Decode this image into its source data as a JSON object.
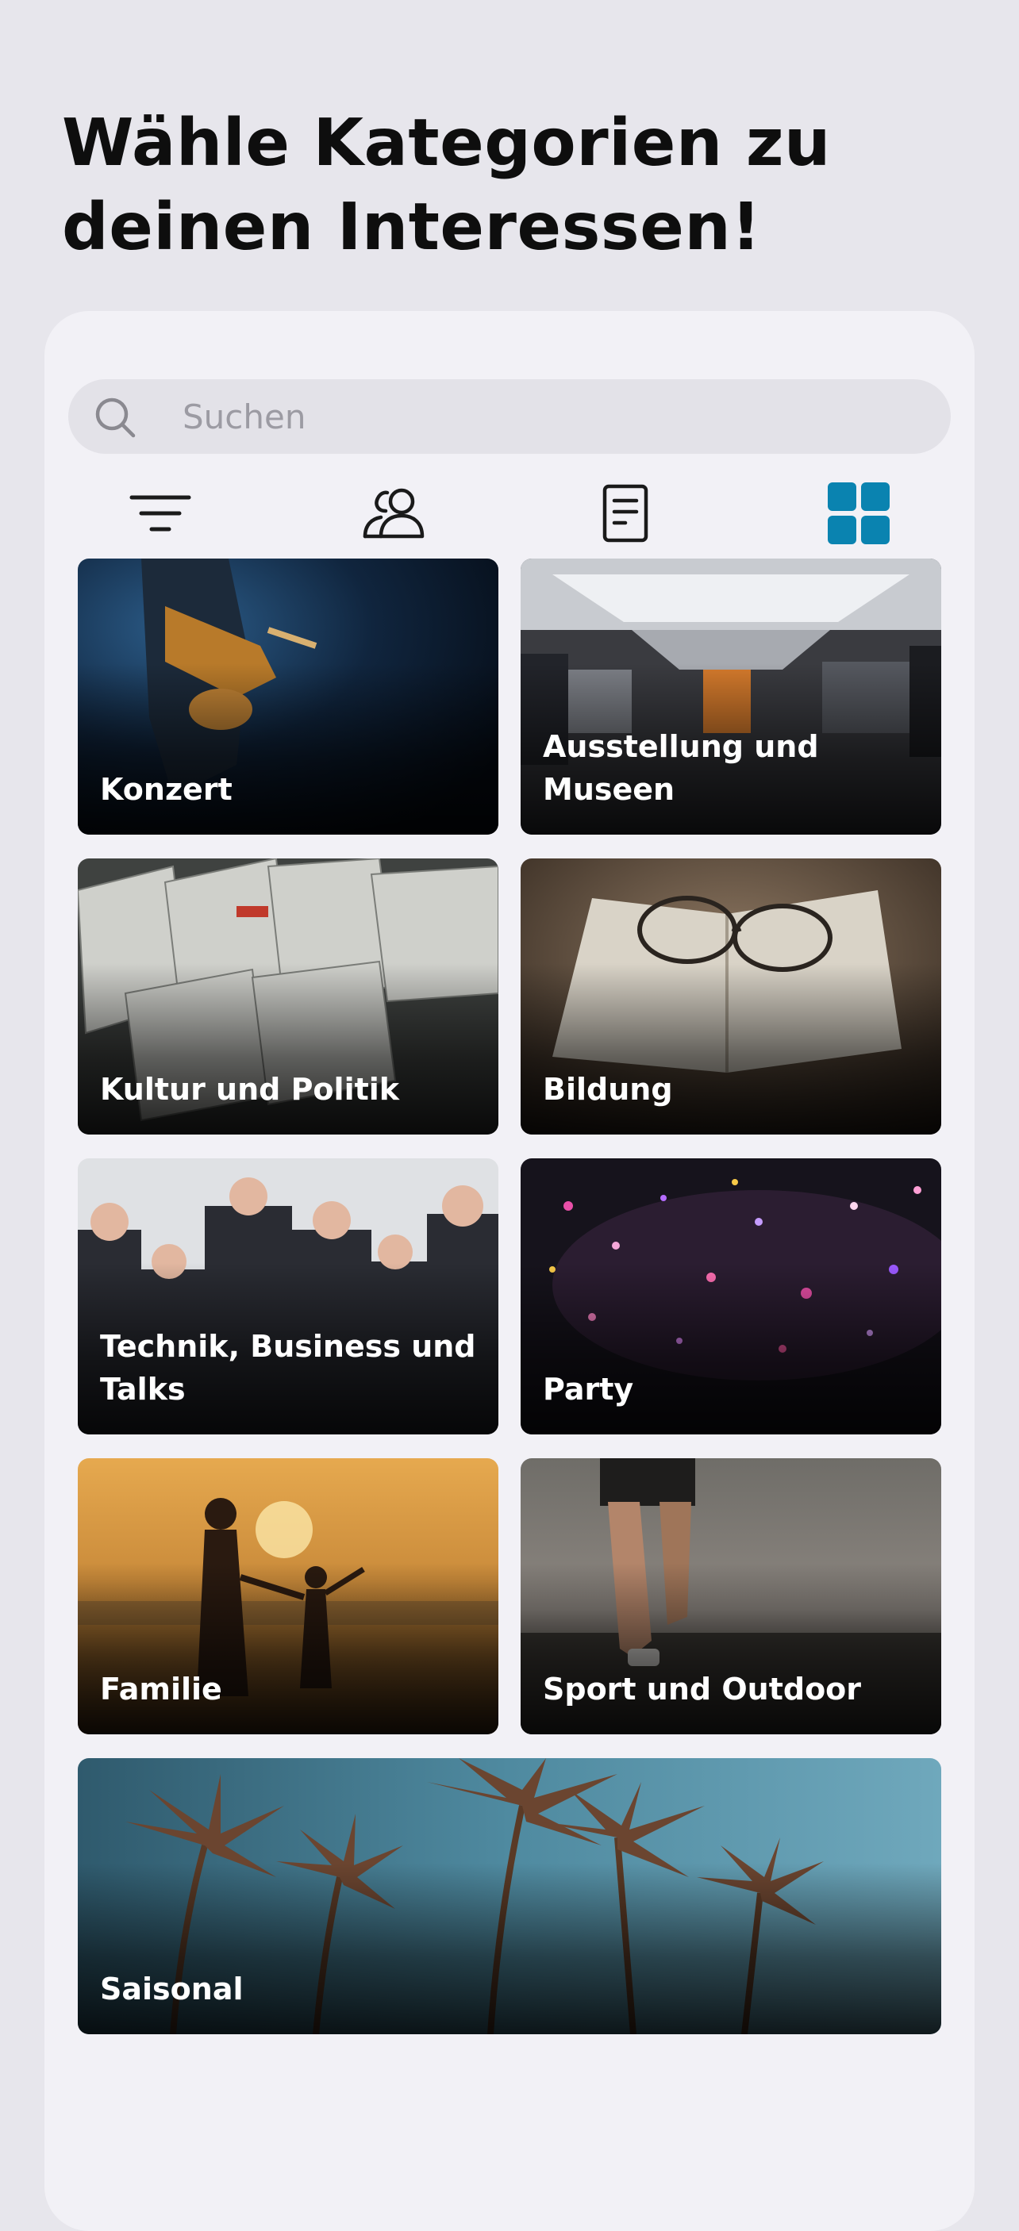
{
  "headline": "Wähle Kategorien zu\ndeinen Interessen!",
  "search": {
    "placeholder": "Suchen"
  },
  "toolbar": {
    "tabs": [
      {
        "icon": "filter-icon",
        "active": false
      },
      {
        "icon": "people-icon",
        "active": false
      },
      {
        "icon": "document-icon",
        "active": false
      },
      {
        "icon": "grid-icon",
        "active": true
      }
    ],
    "accent_color": "#0a83b0"
  },
  "categories": [
    {
      "label": "Konzert",
      "icon": "concert-image"
    },
    {
      "label": "Ausstellung und\nMuseen",
      "icon": "museum-image"
    },
    {
      "label": "Kultur und Politik",
      "icon": "newspaper-image"
    },
    {
      "label": "Bildung",
      "icon": "book-glasses-image"
    },
    {
      "label": "Technik, Business und\nTalks",
      "icon": "business-meeting-image"
    },
    {
      "label": "Party",
      "icon": "confetti-image"
    },
    {
      "label": "Familie",
      "icon": "family-sunset-image"
    },
    {
      "label": "Sport und Outdoor",
      "icon": "runner-image"
    },
    {
      "label": "Saisonal",
      "icon": "palm-trees-image"
    }
  ]
}
